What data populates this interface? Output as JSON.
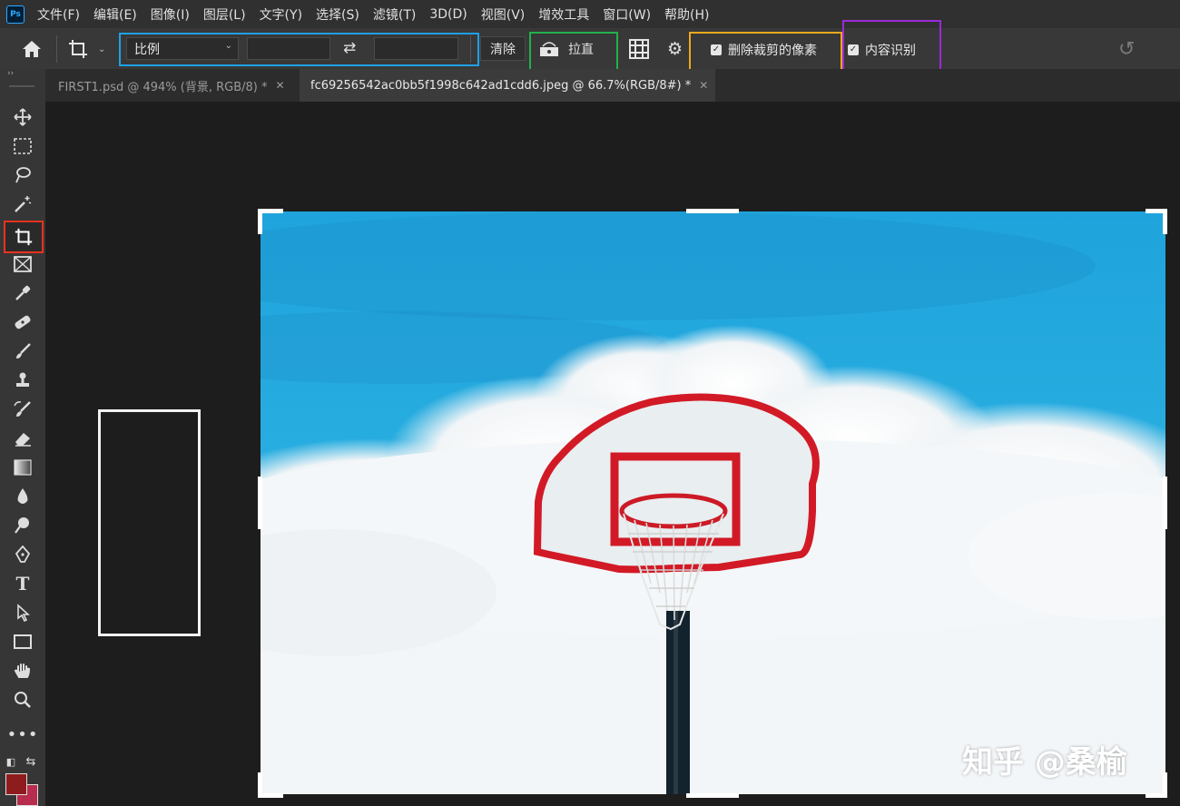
{
  "app": {
    "logo": "Ps"
  },
  "menu": [
    "文件(F)",
    "编辑(E)",
    "图像(I)",
    "图层(L)",
    "文字(Y)",
    "选择(S)",
    "滤镜(T)",
    "3D(D)",
    "视图(V)",
    "增效工具",
    "窗口(W)",
    "帮助(H)"
  ],
  "options": {
    "ratio_label": "比例",
    "width_value": "",
    "height_value": "",
    "clear_label": "清除",
    "straighten_label": "拉直",
    "delete_cropped_label": "删除裁剪的像素",
    "delete_cropped_checked": true,
    "content_aware_label": "内容识别",
    "content_aware_checked": true
  },
  "tabs": [
    {
      "label": "FIRST1.psd @ 494% (背景, RGB/8) *",
      "active": false
    },
    {
      "label": "fc69256542ac0bb5f1998c642ad1cdd6.jpeg @ 66.7%(RGB/8#) *",
      "active": true
    }
  ],
  "tools": [
    "move-tool",
    "marquee-tool",
    "lasso-tool",
    "magic-wand-tool",
    "crop-tool",
    "frame-tool",
    "eyedropper-tool",
    "healing-brush-tool",
    "brush-tool",
    "clone-stamp-tool",
    "history-brush-tool",
    "eraser-tool",
    "gradient-tool",
    "blur-tool",
    "dodge-tool",
    "pen-tool",
    "type-tool",
    "path-selection-tool",
    "rectangle-tool",
    "hand-tool",
    "zoom-tool",
    "more-tools"
  ],
  "active_tool": "crop-tool",
  "colors": {
    "foreground": "#8e1c1e",
    "background": "#b82c4d",
    "highlight_blue": "#1fa0e6",
    "highlight_green": "#22b14c",
    "highlight_yellow": "#f0a81c",
    "highlight_purple": "#9b2ad6",
    "highlight_red": "#e8321e"
  },
  "watermark": "知乎 @桑榆"
}
